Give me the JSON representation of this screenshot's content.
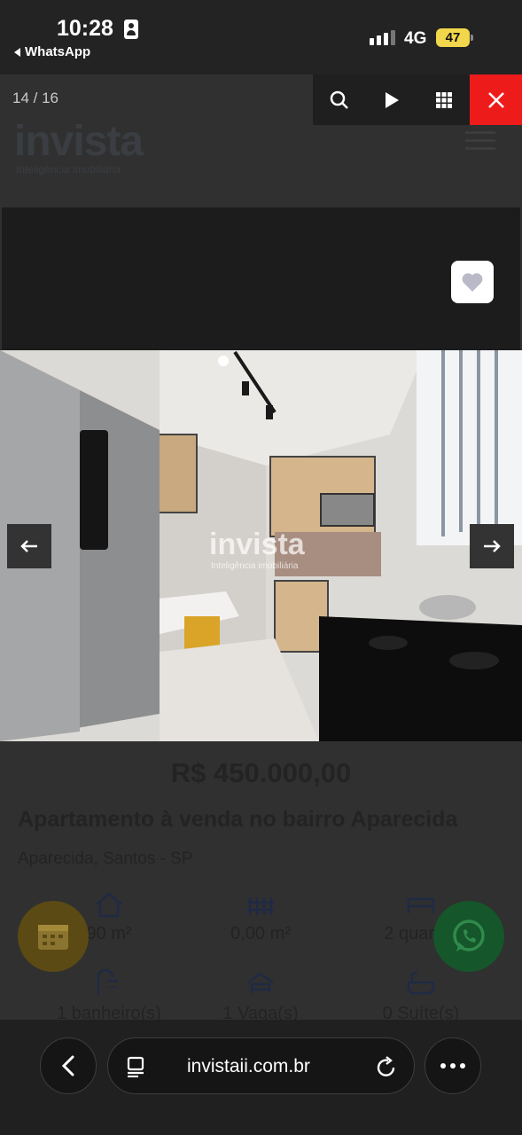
{
  "status_bar": {
    "time": "10:28",
    "back_app": "WhatsApp",
    "network": "4G",
    "battery": "47"
  },
  "site": {
    "logo": "invista",
    "logo_tagline": "Inteligência imobiliária",
    "price": "R$ 450.000,00",
    "title": "Apartamento à venda no bairro Aparecida",
    "location": "Aparecida, Santos - SP",
    "features": [
      {
        "icon": "house-area-icon",
        "text": "90 m²"
      },
      {
        "icon": "fence-area-icon",
        "text": "0,00 m²"
      },
      {
        "icon": "bed-icon",
        "text": "2 quartos"
      },
      {
        "icon": "shower-icon",
        "text": "1 banheiro(s)"
      },
      {
        "icon": "car-icon",
        "text": "1 Vaga(s)"
      },
      {
        "icon": "bathtub-icon",
        "text": "0 Suíte(s)"
      }
    ]
  },
  "gallery": {
    "counter": "14 / 16",
    "watermark": "invista",
    "watermark_sub": "Inteligência imobiliária"
  },
  "browser": {
    "url": "invistaii.com.br"
  },
  "colors": {
    "close_red": "#ee1b1b",
    "whatsapp_green": "#15562a",
    "calendar_gold": "#5b4a14"
  }
}
